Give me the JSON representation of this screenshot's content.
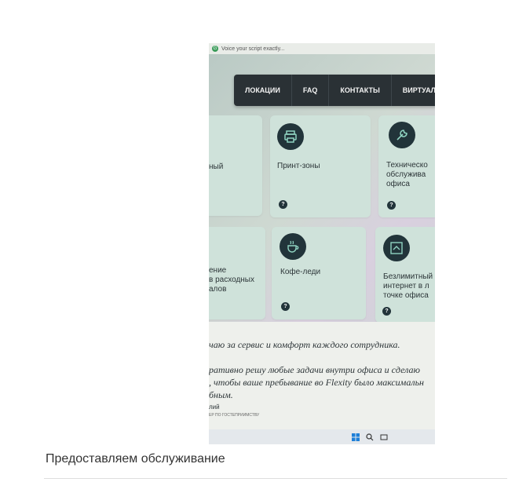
{
  "photo": {
    "browser_bar": {
      "text": "Voice your script exactly..."
    },
    "nav": {
      "items": [
        "ЛОКАЦИИ",
        "FAQ",
        "КОНТАКТЫ",
        "ВИРТУАЛЬНЫЙ"
      ]
    },
    "cards": [
      {
        "label": "ный",
        "icon": "none"
      },
      {
        "label": "Принт-зоны",
        "icon": "printer-icon"
      },
      {
        "label": "Техническо\nобслужива\nофиса",
        "icon": "wrench-icon"
      },
      {
        "label": "ение\nв расходных\nалов",
        "icon": "none"
      },
      {
        "label": "Кофе-леди",
        "icon": "coffee-cup-icon"
      },
      {
        "label": "Безлимитный\nинтернет в л\nточке офиса",
        "icon": "router-icon"
      }
    ],
    "help_mark": "?",
    "about": {
      "line1": "чаю за сервис и комфорт каждого сотрудника.",
      "line2": "ративно решу любые задачи внутри офиса и сделаю",
      "line3": ", чтобы ваше пребывание во Flexity было максимальн",
      "line4": "бным.",
      "signature_name": "лий",
      "signature_role": "ЕР ПО ГОСТЕПРИИМСТВУ"
    }
  },
  "caption": "Предоставляем обслуживание"
}
